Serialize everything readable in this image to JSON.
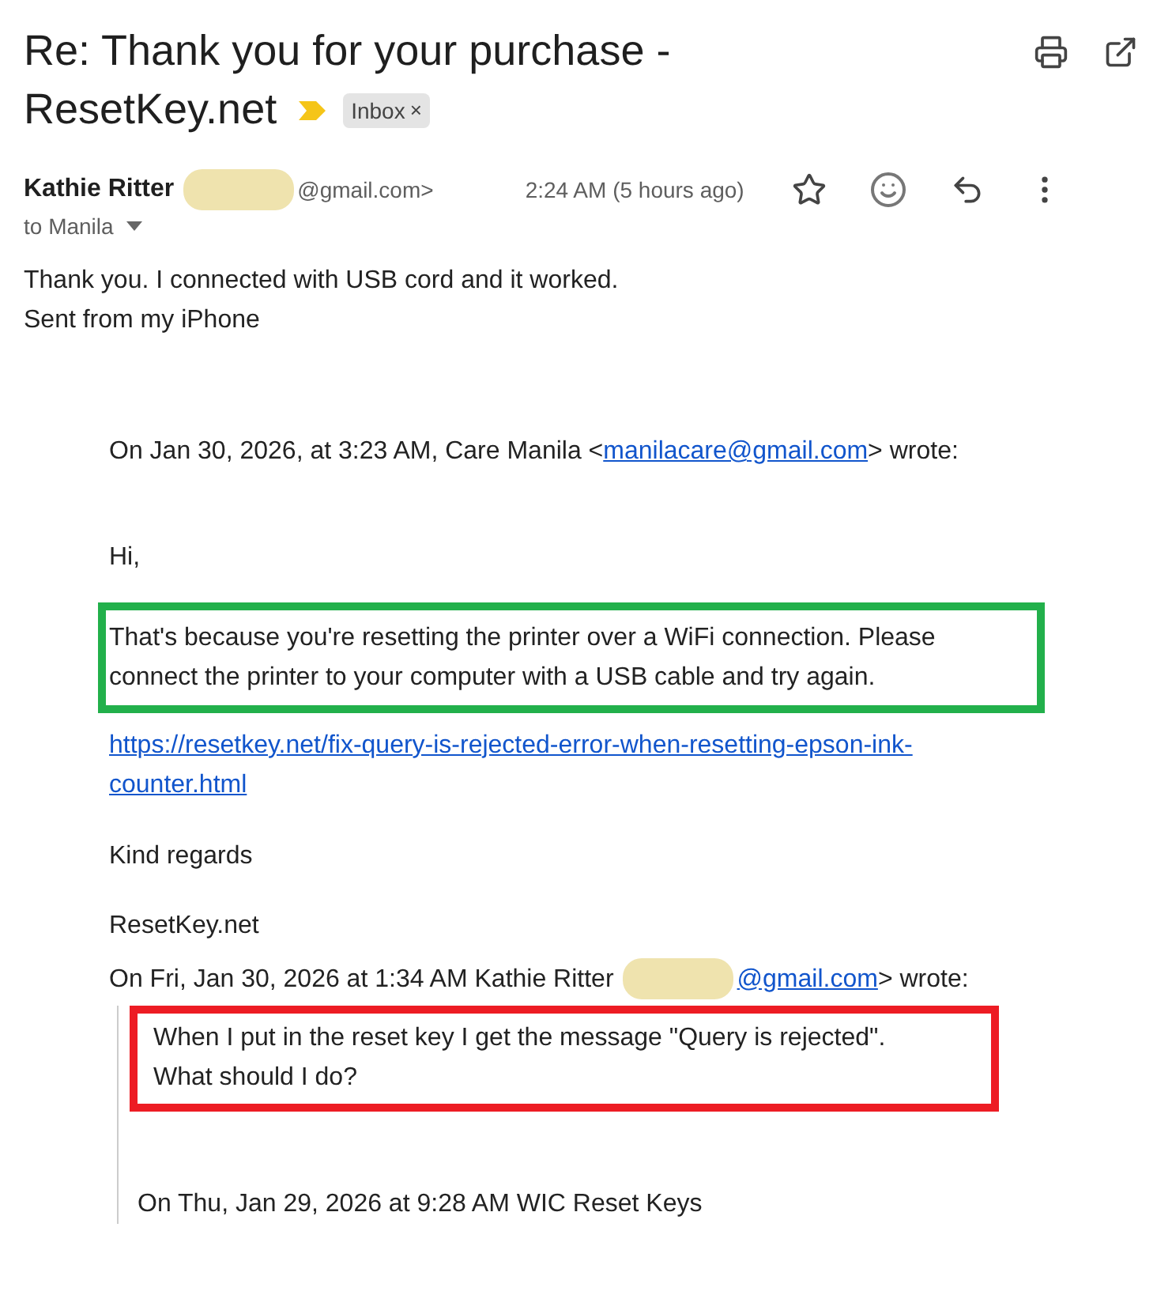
{
  "subject": {
    "title_lines": [
      "Re: Thank you for your purchase -",
      "ResetKey.net"
    ],
    "important": true,
    "label": "Inbox",
    "label_close": "×"
  },
  "sender": {
    "name": "Kathie Ritter",
    "email_tail": "@gmail.com>",
    "time": "2:24 AM (5 hours ago)",
    "recipient": "to Manila",
    "starred": false
  },
  "body": [
    "Thank you. I connected with USB cord and it worked.",
    "Sent from my iPhone"
  ],
  "quote": {
    "header": {
      "prefix": "On Jan 30, 2026, at 3:23 AM, Care Manila <",
      "link": "manilacare@gmail.com",
      "suffix": "> wrote:"
    },
    "greeting": "Hi,",
    "highlight": {
      "text": "That's because you're resetting the printer over a WiFi connection. Please connect the printer to your computer with a USB cable and try again.",
      "color": "#22b04b"
    },
    "link": "https://resetkey.net/fix-query-is-rejected-error-when-resetting-epson-ink-counter.html",
    "closing": "Kind regards",
    "signature": "ResetKey.net",
    "reply_header": {
      "prefix": "On Fri, Jan 30, 2026 at 1:34 AM Kathie Ritter",
      "link": "@gmail.com",
      "suffix": "> wrote:"
    },
    "reply_highlight": {
      "lines": [
        "When I put in the reset key I get the message \"Query is rejected\".",
        "What should I do?"
      ],
      "color": "#ed1c24"
    },
    "nested_header": "On Thu, Jan 29, 2026 at 9:28 AM WIC Reset Keys"
  }
}
